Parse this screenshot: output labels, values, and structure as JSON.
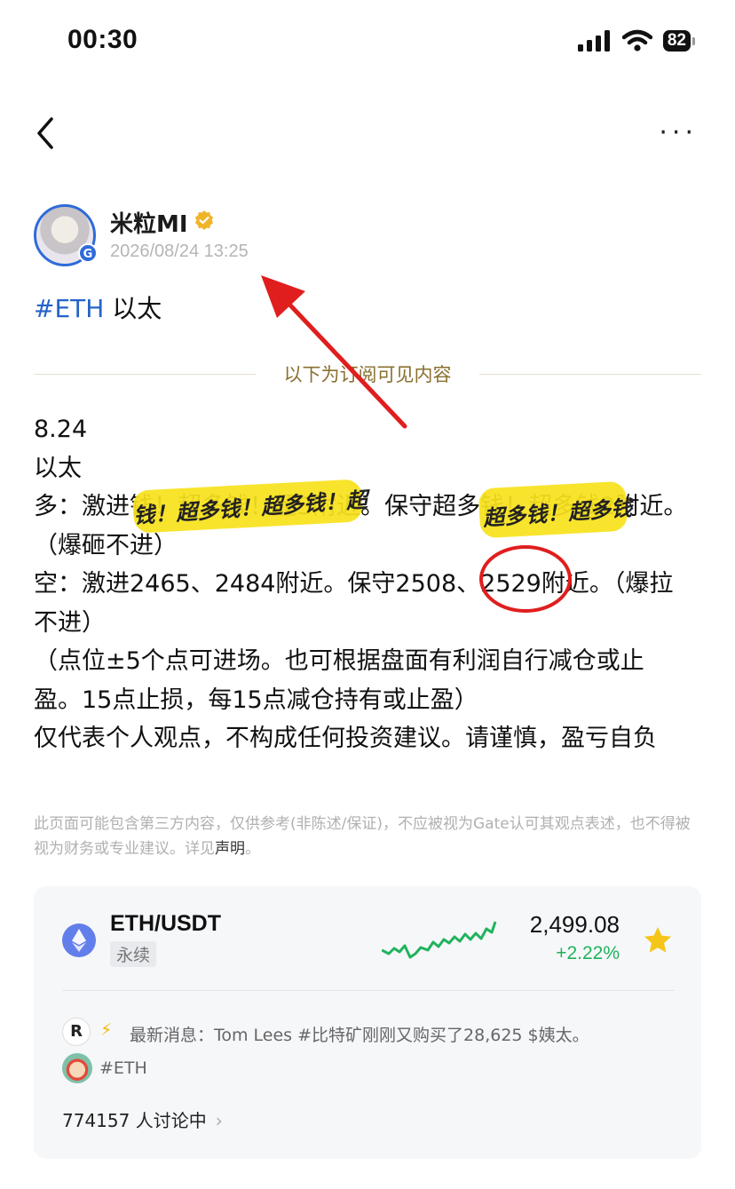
{
  "status_bar": {
    "time": "00:30",
    "battery": "82"
  },
  "nav": {
    "back_icon": "chevron-left-icon",
    "more_icon": "more-horizontal-icon",
    "more_label": "···"
  },
  "author": {
    "name": "米粒MI",
    "timestamp": "2026/08/24 13:25",
    "avatar_badge": "G"
  },
  "post": {
    "topic_tag": "#ETH",
    "topic_text": " 以太",
    "subscription_divider": "以下为订阅可见内容",
    "lines": [
      "8.24",
      "以太",
      "多：激进钱！超多钱！超3附近。保守超多钱！超多钱2附近。（爆砸不进）",
      "空：激进2465、2484附近。保守2508、2529附近。（爆拉不进）",
      "（点位±5个点可进场。也可根据盘面有利润自行减仓或止盈。15点止损，每15点减仓持有或止盈）",
      "仅代表个人观点，不构成任何投资建议。请谨慎，盈亏自负"
    ],
    "scrawl_1": "钱！超多钱！超多钱！超",
    "scrawl_2": "超多钱！超多钱"
  },
  "disclaimer": {
    "text": "此页面可能包含第三方内容，仅供参考(非陈述/保证)，不应被视为Gate认可其观点表述，也不得被视为财务或专业建议。详见",
    "link": "声明",
    "end": "。"
  },
  "ticker": {
    "pair": "ETH/USDT",
    "type": "永续",
    "price": "2,499.08",
    "change": "+2.22%",
    "change_color": "#1fb35c",
    "sparkline_trend": "up"
  },
  "feed": {
    "news_label": "最新消息：Tom Lees #比特矿刚刚又购买了28,625 $姨太。",
    "news_logo": "R",
    "tag": "#ETH",
    "discussion": "774157 人讨论中"
  },
  "colors": {
    "accent_blue": "#2563c9",
    "gold": "#8a7030",
    "annotation_red": "#e01e1e",
    "highlight_yellow": "#f7e21c"
  }
}
